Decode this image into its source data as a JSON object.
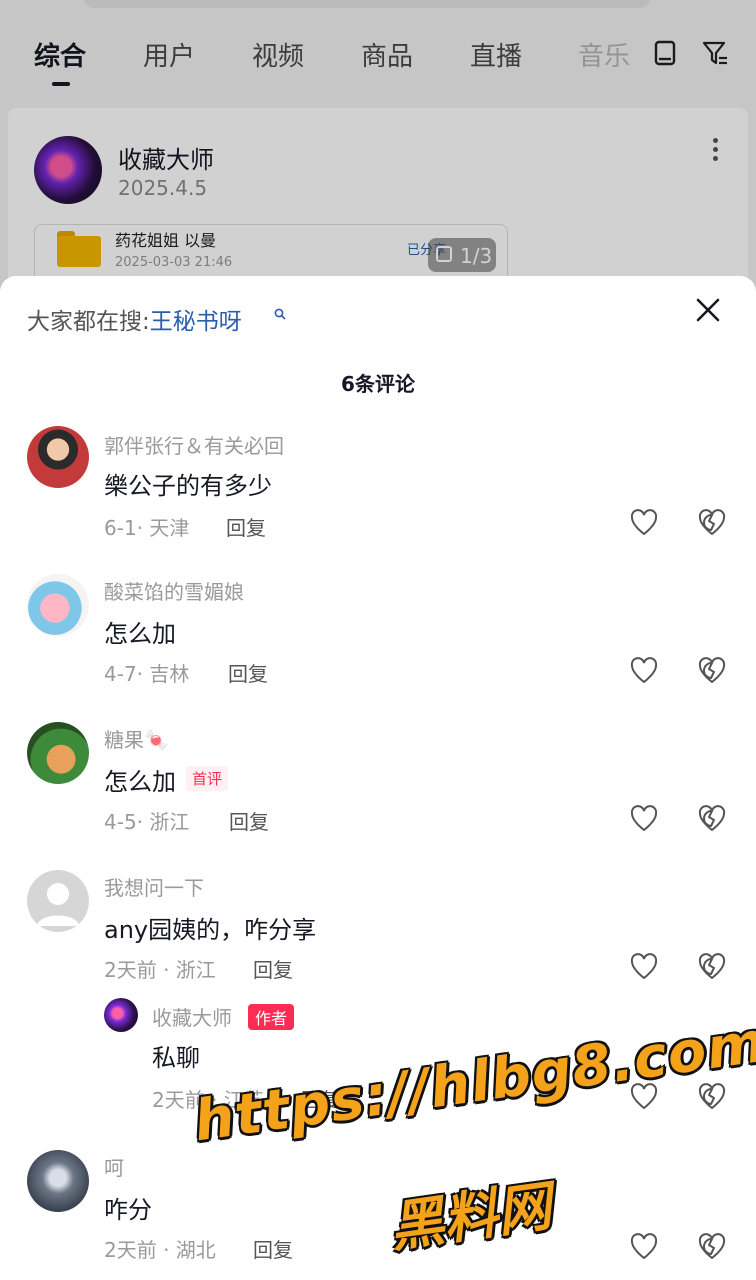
{
  "tabs": [
    {
      "label": "综合",
      "active": true
    },
    {
      "label": "用户"
    },
    {
      "label": "视频"
    },
    {
      "label": "商品"
    },
    {
      "label": "直播"
    },
    {
      "label": "音乐"
    }
  ],
  "post": {
    "author": "收藏大师",
    "date": "2025.4.5",
    "file": {
      "name": "药花姐姐 以曼",
      "date": "2025-03-03 21:46",
      "shared_label": "已分享"
    },
    "pager": "1/3"
  },
  "sheet": {
    "trending_prefix": "大家都在搜:",
    "trending_term": "王秘书呀",
    "title": "6条评论",
    "reply_label": "回复"
  },
  "comments": [
    {
      "name": "郭伴张行＆有关必回",
      "text": "樂公子的有多少",
      "meta": "6-1· 天津"
    },
    {
      "name": "酸菜馅的雪媚娘",
      "text": "怎么加",
      "meta": "4-7· 吉林"
    },
    {
      "name": "糖果🍬",
      "text": "怎么加",
      "meta": "4-5· 浙江",
      "badge": "首评"
    },
    {
      "name": "我想问一下",
      "text": "any园姨的，咋分享",
      "meta": "2天前 · 浙江"
    },
    {
      "name": "收藏大师",
      "text": "私聊",
      "meta": "2天前 · 江苏",
      "badge": "作者"
    },
    {
      "name": "呵",
      "text": "咋分",
      "meta": "2天前 · 湖北"
    }
  ],
  "watermark": {
    "url": "https://hlbg8.com",
    "site": "黑料网"
  },
  "colors": {
    "accent": "#fe2c55",
    "link": "#2a5db0",
    "watermark": "#f4a21a"
  }
}
